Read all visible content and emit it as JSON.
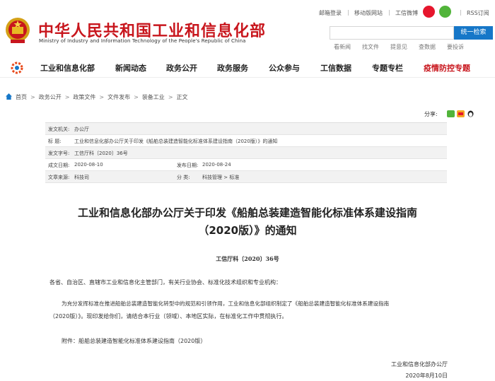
{
  "header": {
    "site_title": "中华人民共和国工业和信息化部",
    "site_subtitle": "Ministry of Industry and Information Technology of the People's Republic of China",
    "toplinks": [
      "邮箱登录",
      "移动版网站",
      "工信微博",
      "RSS订阅"
    ],
    "search_button": "统一检索",
    "quicklinks": [
      "看新闻",
      "找文件",
      "提意见",
      "查数据",
      "要投诉"
    ]
  },
  "nav": {
    "items": [
      "工业和信息化部",
      "新闻动态",
      "政务公开",
      "政务服务",
      "公众参与",
      "工信数据",
      "专题专栏",
      "疫情防控专题"
    ]
  },
  "breadcrumb": [
    "首页",
    "政务公开",
    "政策文件",
    "文件发布",
    "装备工业",
    "正文"
  ],
  "share_label": "分享:",
  "info": {
    "row1": {
      "label": "发文机关:",
      "value": "办公厅"
    },
    "row2": {
      "label": "标    题:",
      "value": "工业和信息化部办公厅关于印发《船舶总装建造智能化标准体系建设指南（2020版）》的通知"
    },
    "row3": {
      "label": "发文字号:",
      "value": "工信厅科〔2020〕36号"
    },
    "row4": {
      "label": "成文日期:",
      "value": "2020-08-10",
      "label2": "发布日期:",
      "value2": "2020-08-24"
    },
    "row5": {
      "label": "文章来源:",
      "value": "科技司",
      "label2": "分    类:",
      "value2": "科技管理 > 标准"
    }
  },
  "document": {
    "title_line1": "工业和信息化部办公厅关于印发《船舶总装建造智能化标准体系建设指南",
    "title_line2": "（2020版）》的通知",
    "number": "工信厅科〔2020〕36号",
    "addressee": "各省、自治区、直辖市工业和信息化主管部门，有关行业协会、标准化技术组织和专业机构：",
    "body_line1": "为充分发挥标准在推进船舶总装建造智能化转型中的规范和引领作用，工业和信息化部组织制定了《船舶总装建造智能化标准体系建设指南",
    "body_line2": "（2020版）》。现印发给你们，请结合本行业（领域）、本地区实际，在标准化工作中贯彻执行。",
    "attachment": "附件：船舶总装建造智能化标准体系建设指南（2020版）",
    "signer": "工业和信息化部办公厅",
    "date": "2020年8月10日"
  },
  "colors": {
    "brand_red": "#c8161d",
    "search_blue": "#1677c8"
  }
}
